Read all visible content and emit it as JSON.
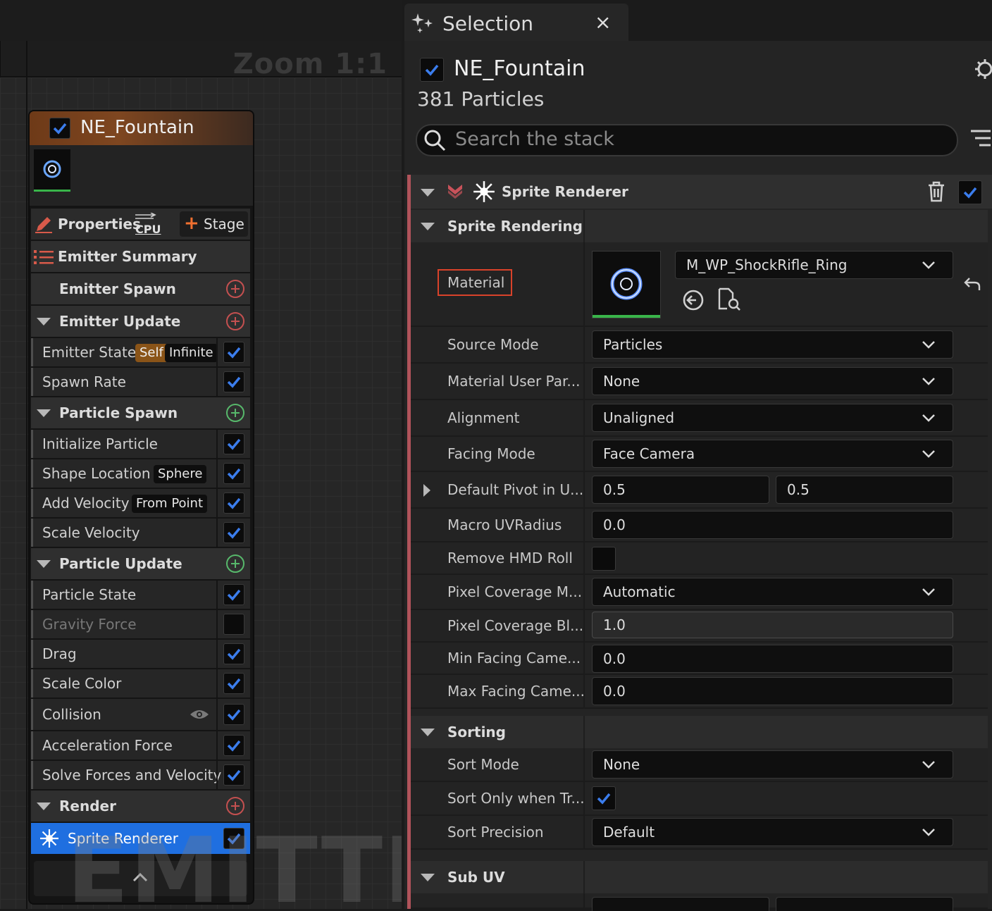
{
  "graph": {
    "zoom": "Zoom 1:1",
    "watermark": "EMITTER"
  },
  "node": {
    "title": "NE_Fountain",
    "properties_label": "Properties",
    "cpu_badge": "CPU",
    "stage_label": "Stage",
    "summary_label": "Emitter Summary",
    "sections": {
      "emitter_spawn": "Emitter Spawn",
      "emitter_update": "Emitter Update",
      "particle_spawn": "Particle Spawn",
      "particle_update": "Particle Update",
      "render": "Render"
    },
    "items": {
      "emitter_state": "Emitter State",
      "emitter_state_tag1": "Self",
      "emitter_state_tag2": "Infinite",
      "spawn_rate": "Spawn Rate",
      "initialize_particle": "Initialize Particle",
      "shape_location": "Shape Location",
      "shape_location_tag": "Sphere",
      "add_velocity": "Add Velocity",
      "add_velocity_tag": "From Point",
      "scale_velocity": "Scale Velocity",
      "particle_state": "Particle State",
      "gravity_force": "Gravity Force",
      "drag": "Drag",
      "scale_color": "Scale Color",
      "collision": "Collision",
      "acceleration_force": "Acceleration Force",
      "solve_forces": "Solve Forces and Velocity",
      "sprite_renderer": "Sprite Renderer"
    },
    "colors": {
      "header": "#7a4420",
      "selected": "#1f6fe0",
      "check": "#3b7ded",
      "add_green": "#57b86b",
      "add_red": "#c45050"
    }
  },
  "panel": {
    "tab_title": "Selection",
    "tab_close": "×",
    "emitter_name": "NE_Fountain",
    "particle_count": "381 Particles",
    "search_placeholder": "Search the stack",
    "renderer_title": "Sprite Renderer",
    "sections": {
      "sprite_rendering": "Sprite Rendering",
      "sorting": "Sorting",
      "sub_uv": "Sub UV"
    },
    "props": {
      "material": {
        "name": "Material",
        "value": "M_WP_ShockRifle_Ring"
      },
      "source_mode": {
        "name": "Source Mode",
        "value": "Particles"
      },
      "material_user_param": {
        "name": "Material User Par...",
        "value": "None"
      },
      "alignment": {
        "name": "Alignment",
        "value": "Unaligned"
      },
      "facing_mode": {
        "name": "Facing Mode",
        "value": "Face Camera"
      },
      "default_pivot": {
        "name": "Default Pivot in U...",
        "x": "0.5",
        "y": "0.5"
      },
      "macro_uv_radius": {
        "name": "Macro UVRadius",
        "value": "0.0"
      },
      "remove_hmd_roll": {
        "name": "Remove HMD Roll",
        "checked": false
      },
      "pixel_coverage_mode": {
        "name": "Pixel Coverage M...",
        "value": "Automatic"
      },
      "pixel_coverage_blend": {
        "name": "Pixel Coverage Bl...",
        "value": "1.0"
      },
      "min_facing": {
        "name": "Min Facing Came...",
        "value": "0.0"
      },
      "max_facing": {
        "name": "Max Facing Came...",
        "value": "0.0"
      },
      "sort_mode": {
        "name": "Sort Mode",
        "value": "None"
      },
      "sort_only_when": {
        "name": "Sort Only when Tr...",
        "checked": true
      },
      "sort_precision": {
        "name": "Sort Precision",
        "value": "Default"
      }
    },
    "colors": {
      "accent_border": "#b0535a",
      "highlight_box": "#d9422a"
    }
  }
}
